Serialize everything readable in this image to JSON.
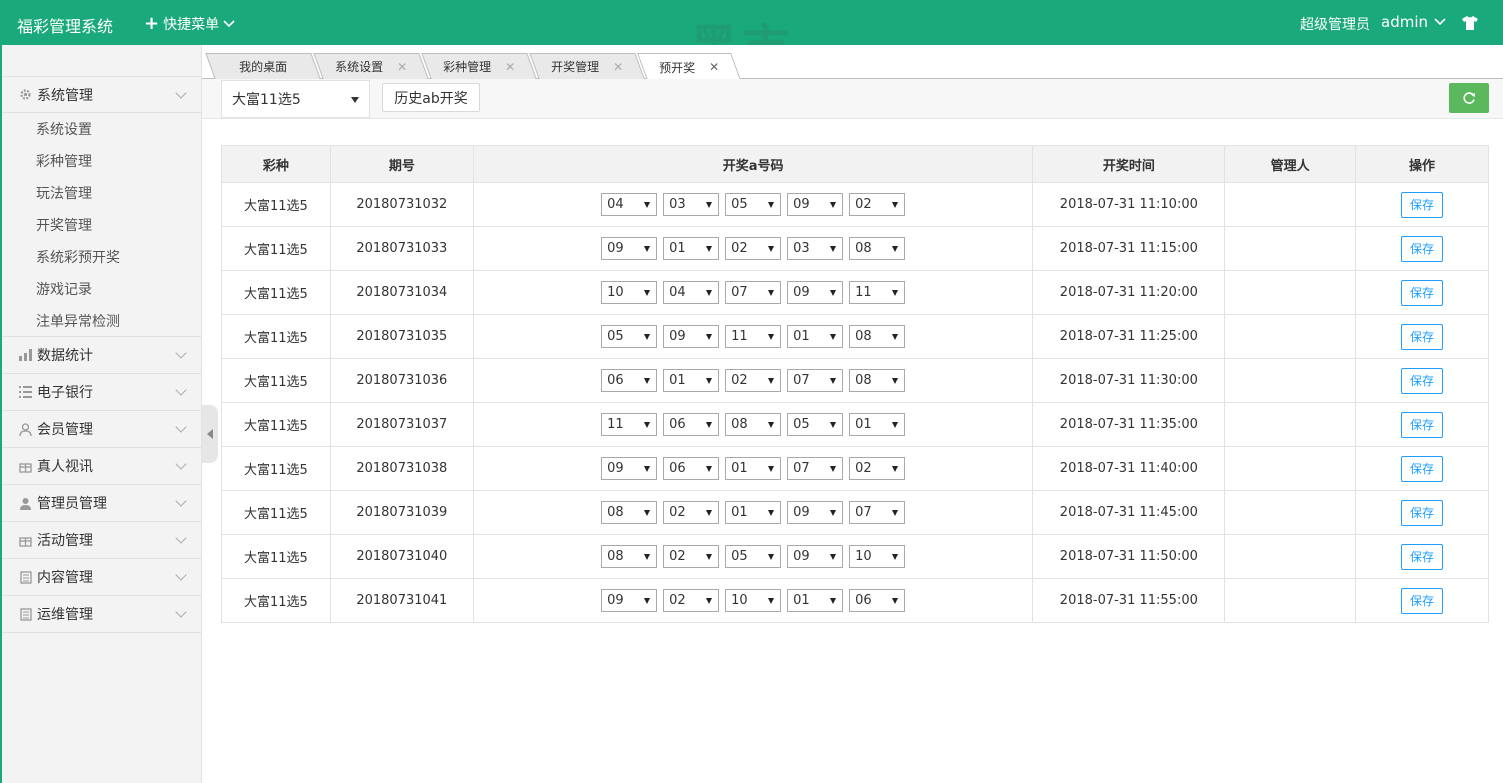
{
  "header": {
    "brand": "福彩管理系统",
    "quick_menu": "快捷菜单",
    "role": "超级管理员",
    "username": "admin",
    "watermark_big": "黑市",
    "watermark_small": "BLACKMARKET",
    "bg_color": "#1aa97a"
  },
  "sidebar": {
    "groups": [
      {
        "label": "系统管理",
        "icon": "gear-icon",
        "subs": [
          "系统设置",
          "彩种管理",
          "玩法管理",
          "开奖管理",
          "系统彩预开奖",
          "游戏记录",
          "注单异常检测"
        ]
      },
      {
        "label": "数据统计",
        "icon": "bar-chart-icon"
      },
      {
        "label": "电子银行",
        "icon": "list-icon"
      },
      {
        "label": "会员管理",
        "icon": "user-outline-icon"
      },
      {
        "label": "真人视讯",
        "icon": "gift-icon"
      },
      {
        "label": "管理员管理",
        "icon": "user-icon"
      },
      {
        "label": "活动管理",
        "icon": "gift-icon"
      },
      {
        "label": "内容管理",
        "icon": "document-icon"
      },
      {
        "label": "运维管理",
        "icon": "document-icon"
      }
    ]
  },
  "tabs": [
    {
      "label": "我的桌面",
      "closable": false
    },
    {
      "label": "系统设置",
      "closable": true
    },
    {
      "label": "彩种管理",
      "closable": true
    },
    {
      "label": "开奖管理",
      "closable": true
    },
    {
      "label": "预开奖",
      "closable": true,
      "active": true
    }
  ],
  "toolbar": {
    "lottery_selected": "大富11选5",
    "history_button": "历史ab开奖"
  },
  "table": {
    "headers": [
      "彩种",
      "期号",
      "开奖a号码",
      "开奖时间",
      "管理人",
      "操作"
    ],
    "save_label": "保存",
    "rows": [
      {
        "lottery": "大富11选5",
        "issue": "20180731032",
        "nums": [
          "04",
          "03",
          "05",
          "09",
          "02"
        ],
        "time": "2018-07-31 11:10:00",
        "admin": ""
      },
      {
        "lottery": "大富11选5",
        "issue": "20180731033",
        "nums": [
          "09",
          "01",
          "02",
          "03",
          "08"
        ],
        "time": "2018-07-31 11:15:00",
        "admin": ""
      },
      {
        "lottery": "大富11选5",
        "issue": "20180731034",
        "nums": [
          "10",
          "04",
          "07",
          "09",
          "11"
        ],
        "time": "2018-07-31 11:20:00",
        "admin": ""
      },
      {
        "lottery": "大富11选5",
        "issue": "20180731035",
        "nums": [
          "05",
          "09",
          "11",
          "01",
          "08"
        ],
        "time": "2018-07-31 11:25:00",
        "admin": ""
      },
      {
        "lottery": "大富11选5",
        "issue": "20180731036",
        "nums": [
          "06",
          "01",
          "02",
          "07",
          "08"
        ],
        "time": "2018-07-31 11:30:00",
        "admin": ""
      },
      {
        "lottery": "大富11选5",
        "issue": "20180731037",
        "nums": [
          "11",
          "06",
          "08",
          "05",
          "01"
        ],
        "time": "2018-07-31 11:35:00",
        "admin": ""
      },
      {
        "lottery": "大富11选5",
        "issue": "20180731038",
        "nums": [
          "09",
          "06",
          "01",
          "07",
          "02"
        ],
        "time": "2018-07-31 11:40:00",
        "admin": ""
      },
      {
        "lottery": "大富11选5",
        "issue": "20180731039",
        "nums": [
          "08",
          "02",
          "01",
          "09",
          "07"
        ],
        "time": "2018-07-31 11:45:00",
        "admin": ""
      },
      {
        "lottery": "大富11选5",
        "issue": "20180731040",
        "nums": [
          "08",
          "02",
          "05",
          "09",
          "10"
        ],
        "time": "2018-07-31 11:50:00",
        "admin": ""
      },
      {
        "lottery": "大富11选5",
        "issue": "20180731041",
        "nums": [
          "09",
          "02",
          "10",
          "01",
          "06"
        ],
        "time": "2018-07-31 11:55:00",
        "admin": ""
      }
    ]
  }
}
